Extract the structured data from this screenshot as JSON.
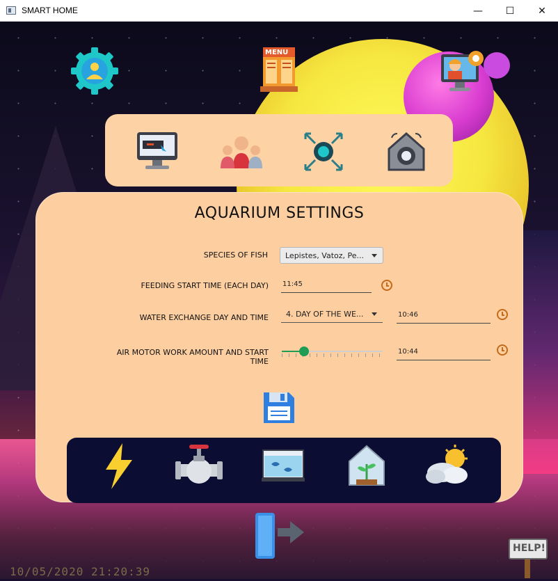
{
  "window": {
    "title": "SMART HOME",
    "minimize": "—",
    "maximize": "☐",
    "close": "✕"
  },
  "header": {
    "menu_icon_text": "MENU"
  },
  "main": {
    "title": "AQUARIUM SETTINGS",
    "species": {
      "label": "SPECIES OF FISH",
      "value": "Lepistes, Vatoz, Pe..."
    },
    "feeding": {
      "label": "FEEDING START TIME (EACH DAY)",
      "value": "11:45"
    },
    "water": {
      "label": "WATER EXCHANGE DAY AND TIME",
      "day_value": "4. DAY OF THE WE...",
      "time_value": "10:46"
    },
    "air": {
      "label": "AIR MOTOR WORK AMOUNT AND START TIME",
      "slider_fraction": 0.22,
      "time_value": "10:44"
    }
  },
  "footer": {
    "datetime": "10/05/2020  21:20:39",
    "help_text": "HELP!"
  },
  "colors": {
    "panel": "#fdcfa0",
    "bottom_bar": "#0c0d33",
    "accent_green": "#1f9d55",
    "clock": "#c46a18"
  }
}
